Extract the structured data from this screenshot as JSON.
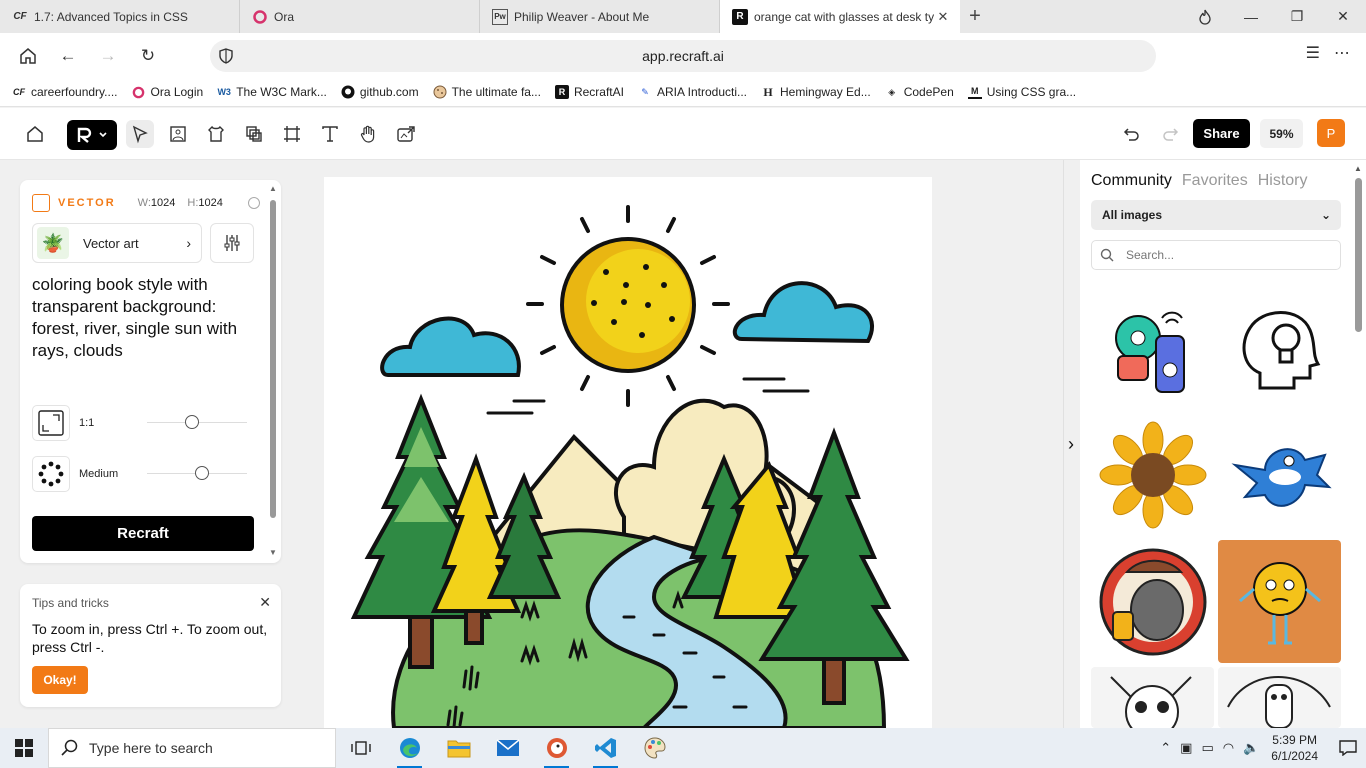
{
  "browser": {
    "tabs": [
      {
        "title": "1.7: Advanced Topics in CSS",
        "icon": "careerfoundry-icon",
        "active": false
      },
      {
        "title": "Ora",
        "icon": "ora-icon",
        "active": false
      },
      {
        "title": "Philip Weaver - About Me",
        "icon": "pw-icon",
        "active": false
      },
      {
        "title": "orange cat with glasses at desk ty",
        "icon": "recraft-icon",
        "active": true
      }
    ],
    "url": "app.recraft.ai",
    "bookmarks": [
      {
        "label": "careerfoundry....",
        "icon": "careerfoundry-icon"
      },
      {
        "label": "Ora Login",
        "icon": "ora-icon"
      },
      {
        "label": "The W3C Mark...",
        "icon": "w3c-icon"
      },
      {
        "label": "github.com",
        "icon": "github-icon"
      },
      {
        "label": "The ultimate fa...",
        "icon": "cookie-icon"
      },
      {
        "label": "RecraftAI",
        "icon": "recraft-icon"
      },
      {
        "label": "ARIA Introducti...",
        "icon": "aria-icon"
      },
      {
        "label": "Hemingway Ed...",
        "icon": "hemingway-icon"
      },
      {
        "label": "CodePen",
        "icon": "codepen-icon"
      },
      {
        "label": "Using CSS gra...",
        "icon": "mdn-icon"
      }
    ]
  },
  "toolbar": {
    "share_label": "Share",
    "zoom": "59%",
    "avatar_letter": "P"
  },
  "left_panel": {
    "mode_label": "VECTOR",
    "width_label": "W:",
    "width_value": "1024",
    "height_label": "H:",
    "height_value": "1024",
    "style_name": "Vector art",
    "prompt": "coloring book style with transparent background: forest, river, single sun with rays, clouds",
    "aspect_label": "1:1",
    "aspect_slider": 0.45,
    "detail_label": "Medium",
    "detail_slider": 0.55,
    "generate_label": "Recraft"
  },
  "tips": {
    "title": "Tips and tricks",
    "body": "To zoom in, press Ctrl +. To zoom out, press Ctrl -.",
    "button": "Okay!"
  },
  "right_panel": {
    "tabs": [
      "Community",
      "Favorites",
      "History"
    ],
    "active_tab": "Community",
    "filter": "All images",
    "search_placeholder": "Search..."
  },
  "taskbar": {
    "search_placeholder": "Type here to search",
    "time": "5:39 PM",
    "date": "6/1/2024"
  },
  "colors": {
    "accent": "#f27a16",
    "primary": "#000000"
  }
}
